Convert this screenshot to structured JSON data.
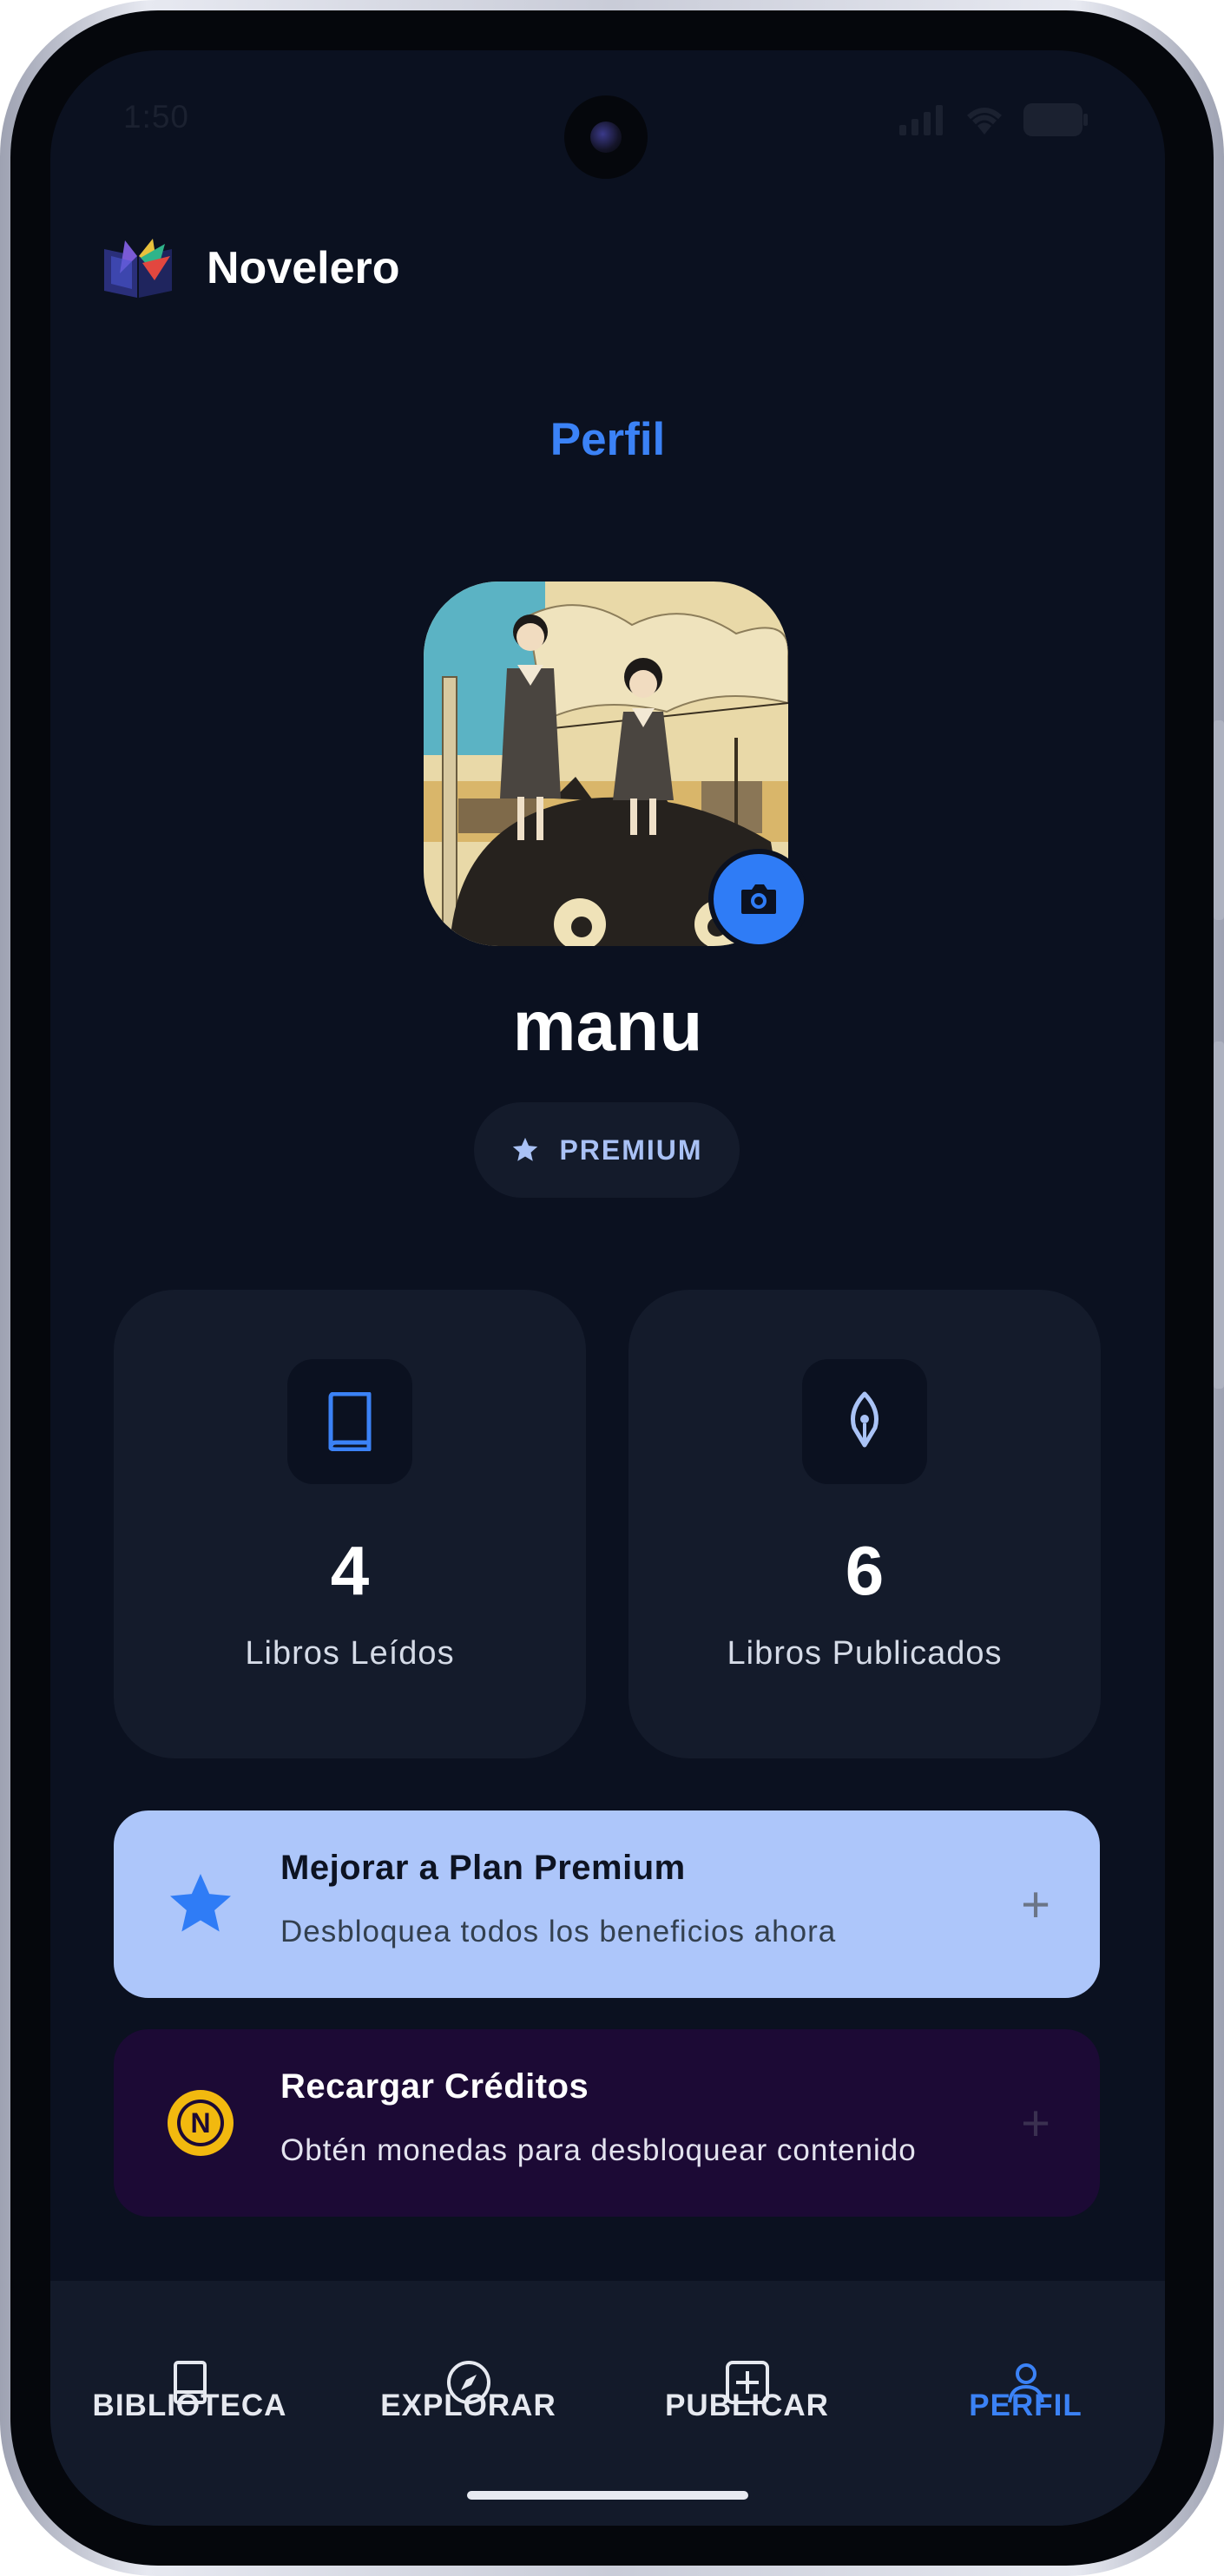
{
  "status_bar": {
    "time": "1:50"
  },
  "header": {
    "app_name": "Novelero",
    "logo_icon": "book-stack-logo"
  },
  "page": {
    "title": "Perfil"
  },
  "profile": {
    "username": "manu",
    "badge_icon": "star-icon",
    "badge_label": "PREMIUM",
    "avatar_icon": "avatar-image",
    "change_photo_icon": "camera-icon"
  },
  "stats": [
    {
      "icon": "book-icon",
      "value": "4",
      "label": "Libros Leídos"
    },
    {
      "icon": "pen-nib-icon",
      "value": "6",
      "label": "Libros Publicados"
    }
  ],
  "actions": [
    {
      "icon": "star-icon",
      "title": "Mejorar a Plan Premium",
      "subtitle": "Desbloquea todos los beneficios ahora",
      "bg": "#adc6fa",
      "title_color": "#0d1322",
      "subtitle_color": "#33404f",
      "plus_color": "#6b7587"
    },
    {
      "icon": "coin-icon",
      "title": "Recargar Créditos",
      "subtitle": "Obtén monedas para desbloquear contenido",
      "bg": "#1c0a35",
      "title_color": "#ffffff",
      "subtitle_color": "#e3e3ef",
      "plus_color": "#3a3050"
    }
  ],
  "nav": [
    {
      "label": "BIBLIOTECA",
      "icon": "book-icon",
      "active": false
    },
    {
      "label": "EXPLORAR",
      "icon": "compass-icon",
      "active": false
    },
    {
      "label": "PUBLICAR",
      "icon": "add-square-icon",
      "active": false
    },
    {
      "label": "PERFIL",
      "icon": "person-icon",
      "active": true
    }
  ],
  "colors": {
    "accent": "#3b82f6",
    "background": "#0b1120",
    "card": "#141b2b",
    "nav_inactive": "#e6e9f0"
  }
}
